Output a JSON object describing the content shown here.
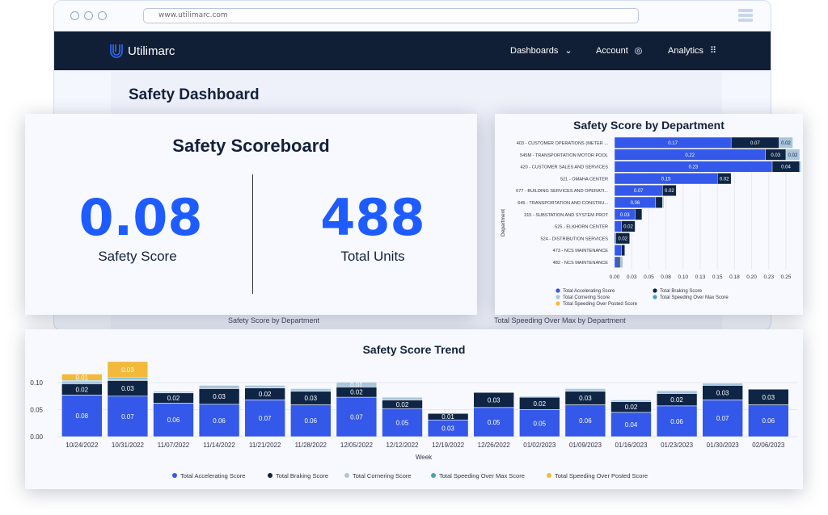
{
  "browser": {
    "url": "www.utilimarc.com"
  },
  "nav": {
    "brand": "Utilimarc",
    "items": [
      {
        "label": "Dashboards",
        "icon": "chevron-circle-icon"
      },
      {
        "label": "Account",
        "icon": "user-circle-icon"
      },
      {
        "label": "Analytics",
        "icon": "grid-icon"
      }
    ]
  },
  "page": {
    "title": "Safety Dashboard",
    "bg_labels": [
      "Safety Score by Department",
      "Total Speeding Over Max by Department"
    ]
  },
  "scoreboard": {
    "title": "Safety Scoreboard",
    "safety_score": "0.08",
    "safety_score_label": "Safety Score",
    "total_units": "488",
    "total_units_label": "Total Units"
  },
  "colors": {
    "accelerating": "#3358ea",
    "braking": "#0f2545",
    "cornering": "#a9c6dc",
    "speeding_max": "#4a9fb8",
    "speeding_posted": "#f2b93b"
  },
  "chart_data": [
    {
      "type": "bar",
      "orientation": "horizontal",
      "stacked": true,
      "title": "Safety Score by Department",
      "ylabel": "Department",
      "xlim": [
        0,
        0.26
      ],
      "xticks": [
        "0.00",
        "0.03",
        "0.05",
        "0.08",
        "0.10",
        "0.13",
        "0.15",
        "0.18",
        "0.20",
        "0.23",
        "0.25"
      ],
      "categories": [
        "403 - CUSTOMER OPERATIONS (METER ...",
        "545M - TRANSPORTATION MOTOR POOL",
        "420 - CUSTOMER SALES AND SERVICES",
        "521 - OMAHA CENTER",
        "677 - BUILDING SERVICES AND OPERATI...",
        "645 - TRANSPORTATION AND CONSTRU...",
        "315 - SUBSTATION AND SYSTEM PROT",
        "525 - ELKHORN CENTER",
        "524 - DISTRIBUTION SERVICES",
        "473 - NCS MAINTENANCE",
        "482 - NCS MAINTENANCE"
      ],
      "series": [
        {
          "name": "Total Accelerating Score",
          "values": [
            0.17,
            0.22,
            0.23,
            0.15,
            0.07,
            0.06,
            0.03,
            0.01,
            0.002,
            0.01,
            0.005
          ]
        },
        {
          "name": "Total Braking Score",
          "values": [
            0.07,
            0.03,
            0.04,
            0.02,
            0.02,
            0.01,
            0.01,
            0.02,
            0.02,
            0.005,
            0.003
          ]
        },
        {
          "name": "Total Cornering Score",
          "values": [
            0.02,
            0.02,
            0.002,
            0,
            0,
            0.002,
            0,
            0,
            0,
            0,
            0.004
          ]
        },
        {
          "name": "Total Speeding Over Max Score",
          "values": [
            0,
            0,
            0,
            0,
            0,
            0,
            0,
            0,
            0,
            0,
            0
          ]
        },
        {
          "name": "Total Speeding Over Posted Score",
          "values": [
            0,
            0,
            0,
            0,
            0,
            0,
            0,
            0,
            0,
            0,
            0
          ]
        }
      ],
      "legend": "bottom"
    },
    {
      "type": "bar",
      "stacked": true,
      "title": "Safety Score Trend",
      "xlabel": "Week",
      "ylim": [
        0,
        0.14
      ],
      "yticks": [
        "0.00",
        "0.05",
        "0.10"
      ],
      "categories": [
        "10/24/2022",
        "10/31/2022",
        "11/07/2022",
        "11/14/2022",
        "11/21/2022",
        "11/28/2022",
        "12/05/2022",
        "12/12/2022",
        "12/19/2022",
        "12/26/2022",
        "01/02/2023",
        "01/09/2023",
        "01/16/2023",
        "01/23/2023",
        "01/30/2023",
        "02/06/2023"
      ],
      "series": [
        {
          "name": "Total Accelerating Score",
          "values": [
            0.077,
            0.075,
            0.062,
            0.06,
            0.068,
            0.059,
            0.073,
            0.052,
            0.031,
            0.054,
            0.05,
            0.059,
            0.045,
            0.057,
            0.068,
            0.059
          ]
        },
        {
          "name": "Total Braking Score",
          "values": [
            0.021,
            0.029,
            0.019,
            0.029,
            0.022,
            0.025,
            0.019,
            0.016,
            0.012,
            0.028,
            0.023,
            0.025,
            0.02,
            0.023,
            0.027,
            0.029
          ]
        },
        {
          "name": "Total Cornering Score",
          "values": [
            0.004,
            0.002,
            0.003,
            0.006,
            0.005,
            0.005,
            0.009,
            0.005,
            0.001,
            0.001,
            0.002,
            0.005,
            0.003,
            0.005,
            0.004,
            0.001
          ]
        },
        {
          "name": "Total Speeding Over Max Score",
          "values": [
            0.002,
            0.003,
            0,
            0,
            0,
            0,
            0,
            0,
            0,
            0,
            0,
            0,
            0,
            0,
            0,
            0
          ]
        },
        {
          "name": "Total Speeding Over Posted Score",
          "values": [
            0.012,
            0.03,
            0,
            0,
            0,
            0,
            0,
            0,
            0,
            0,
            0,
            0,
            0,
            0,
            0,
            0
          ]
        }
      ],
      "legend": "bottom"
    }
  ]
}
